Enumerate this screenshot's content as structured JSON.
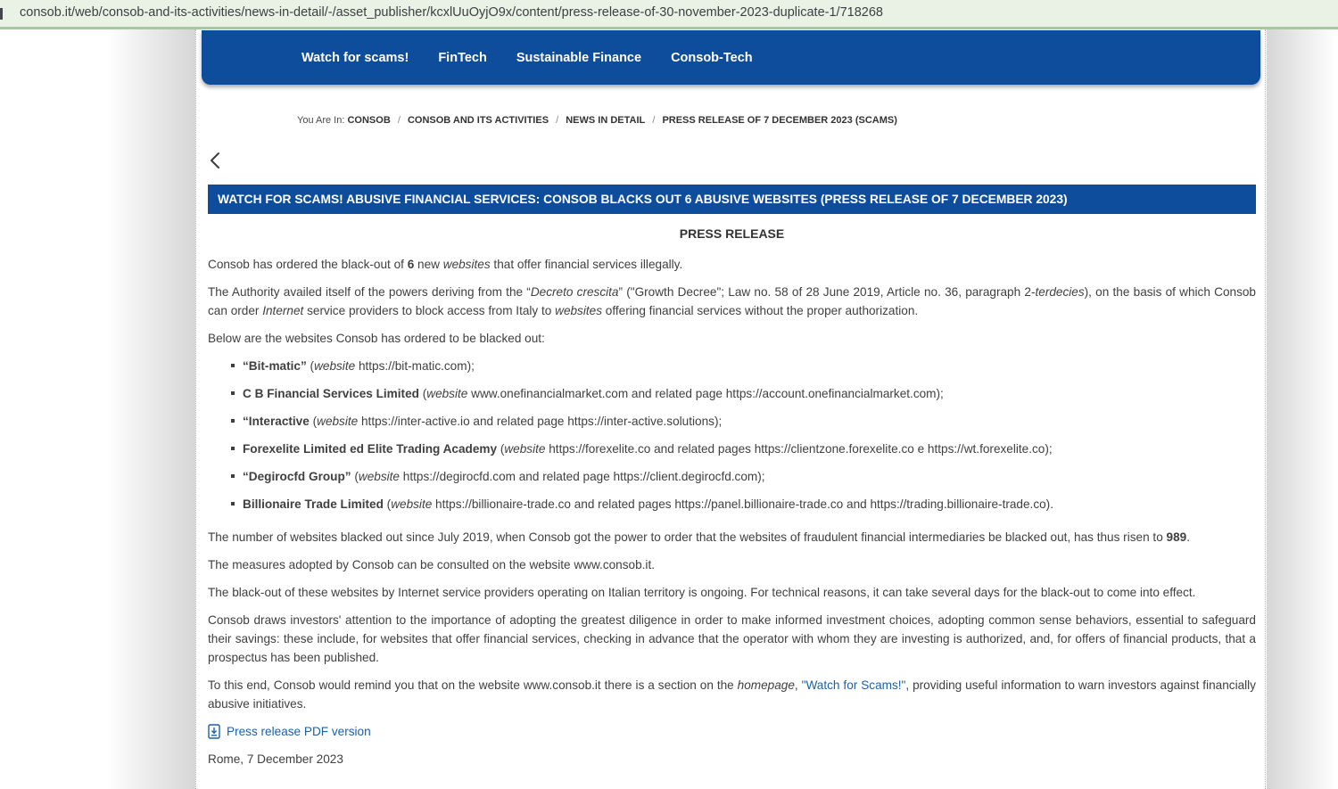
{
  "browser": {
    "url": "consob.it/web/consob-and-its-activities/news-in-detail/-/asset_publisher/kcxlUuOyjO9x/content/press-release-of-30-november-2023-duplicate-1/718268"
  },
  "nav": {
    "items": [
      "Watch for scams!",
      "FinTech",
      "Sustainable Finance",
      "Consob-Tech"
    ]
  },
  "breadcrumb": {
    "prefix": "You Are In:",
    "separator": "/",
    "items": [
      "CONSOB",
      "CONSOB AND ITS ACTIVITIES",
      "NEWS IN DETAIL",
      "PRESS RELEASE OF 7 DECEMBER 2023 (SCAMS)"
    ]
  },
  "article": {
    "banner_title": "WATCH FOR SCAMS! ABUSIVE FINANCIAL SERVICES: CONSOB BLACKS OUT 6 ABUSIVE WEBSITES (PRESS RELEASE OF 7 DECEMBER 2023)",
    "heading": "PRESS RELEASE",
    "paragraphs": [
      [
        {
          "t": "Consob has ordered the black-out of "
        },
        {
          "t": "6",
          "b": true
        },
        {
          "t": " new "
        },
        {
          "t": "websites",
          "i": true
        },
        {
          "t": " that offer financial services illegally."
        }
      ],
      [
        {
          "t": "The Authority availed itself of the powers deriving from the “"
        },
        {
          "t": "Decreto crescita",
          "i": true
        },
        {
          "t": "” (\"Growth Decree\"; Law no. 58 of 28 June 2019, Article no. 36, paragraph 2-"
        },
        {
          "t": "terdecies",
          "i": true
        },
        {
          "t": "), on the basis of which Consob can order "
        },
        {
          "t": "Internet",
          "i": true
        },
        {
          "t": " service providers to block access from Italy to "
        },
        {
          "t": "websites",
          "i": true
        },
        {
          "t": " offering financial services without the proper authorization."
        }
      ],
      [
        {
          "t": "Below are the websites Consob has ordered to be blacked out:"
        }
      ],
      [
        {
          "t": "The number of websites blacked out since July 2019, when Consob got the power to order that the websites of fraudulent financial intermediaries be blacked out, has thus risen to "
        },
        {
          "t": "989",
          "b": true
        },
        {
          "t": "."
        }
      ],
      [
        {
          "t": "The measures adopted by Consob can be consulted on the website www.consob.it."
        }
      ],
      [
        {
          "t": "The black-out of these websites by Internet service providers operating on Italian territory is ongoing. For technical reasons, it can take several days for the black-out to come into effect."
        }
      ],
      [
        {
          "t": "Consob draws investors' attention to the importance of adopting the greatest diligence in order to make informed investment choices, adopting common sense behaviors, essential to safeguard their savings: these include, for websites that offer financial services, checking in advance that the operator with whom they are investing is authorized, and, for offers of financial products, that a prospectus has been published."
        }
      ],
      [
        {
          "t": "To this end, Consob would remind you that on the website www.consob.it there is a section on the "
        },
        {
          "t": "homepage",
          "i": true
        },
        {
          "t": ", "
        },
        {
          "t": "\"Watch for Scams!\"",
          "link": true,
          "name": "watch-for-scams-link"
        },
        {
          "t": ", providing useful information to warn investors against financially abusive initiatives."
        }
      ]
    ],
    "bullets": [
      [
        {
          "t": "“Bit-matic”",
          "b": true
        },
        {
          "t": " ("
        },
        {
          "t": "website",
          "i": true
        },
        {
          "t": " https://bit-matic.com);"
        }
      ],
      [
        {
          "t": "C B Financial Services Limited",
          "b": true
        },
        {
          "t": " ("
        },
        {
          "t": "website",
          "i": true
        },
        {
          "t": " www.onefinancialmarket.com and related page https://account.onefinancialmarket.com);"
        }
      ],
      [
        {
          "t": "“Interactive",
          "b": true
        },
        {
          "t": " ("
        },
        {
          "t": "website",
          "i": true
        },
        {
          "t": " https://inter-active.io and related page https://inter-active.solutions);"
        }
      ],
      [
        {
          "t": "Forexelite Limited ed Elite Trading Academy",
          "b": true
        },
        {
          "t": " ("
        },
        {
          "t": "website",
          "i": true
        },
        {
          "t": " https://forexelite.co and related pages https://clientzone.forexelite.co e https://wt.forexelite.co);"
        }
      ],
      [
        {
          "t": "“Degirocfd Group”",
          "b": true
        },
        {
          "t": " ("
        },
        {
          "t": "website",
          "i": true
        },
        {
          "t": " https://degirocfd.com and related page https://client.degirocfd.com);"
        }
      ],
      [
        {
          "t": "Billionaire Trade Limited",
          "b": true
        },
        {
          "t": " ("
        },
        {
          "t": "website",
          "i": true
        },
        {
          "t": " https://billionaire-trade.co and related pages https://panel.billionaire-trade.co and https://trading.billionaire-trade.co)."
        }
      ]
    ],
    "pdf_link": "Press release PDF version",
    "dateline": "Rome, 7 December 2023"
  },
  "colors": {
    "nav_blue": "#0e4d9b",
    "link_blue": "#1b60ad",
    "urlbar_green": "#e9f2e5",
    "urlbar_border": "#a9c7a1",
    "body_text": "#3f3f3f"
  }
}
